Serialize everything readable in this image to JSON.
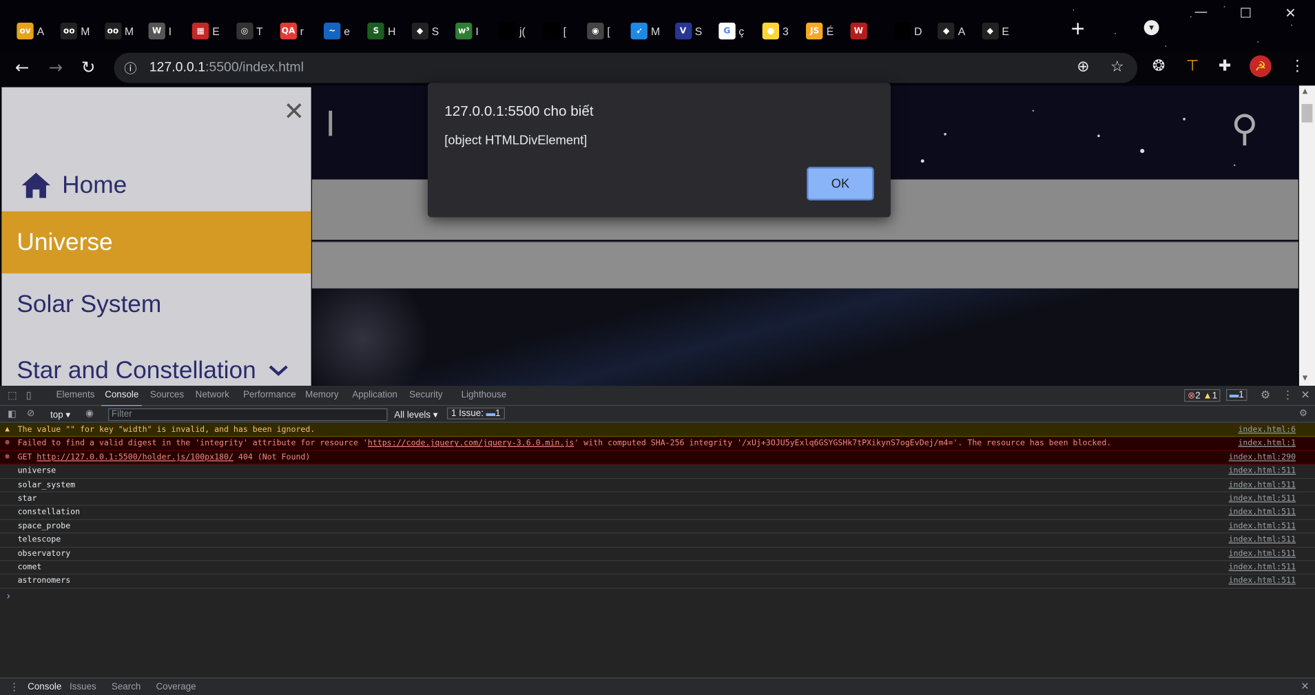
{
  "browser": {
    "tabs": [
      {
        "icon": "ov-icon",
        "text": "A",
        "color": "#e8a317",
        "label": "ov"
      },
      {
        "icon": "owl-icon",
        "text": "M",
        "color": "#222",
        "label": "oo"
      },
      {
        "icon": "owl-icon",
        "text": "M",
        "color": "#222",
        "label": "oo"
      },
      {
        "icon": "wiki-icon",
        "text": "I",
        "color": "#555",
        "label": "W"
      },
      {
        "icon": "grid-icon",
        "text": "E",
        "color": "#c62828",
        "label": "▦"
      },
      {
        "icon": "chrome-icon",
        "text": "T",
        "color": "#333",
        "label": "◎"
      },
      {
        "icon": "qa-icon",
        "text": "r",
        "color": "#e53935",
        "label": "QA"
      },
      {
        "icon": "wave-icon",
        "text": "e",
        "color": "#1565c0",
        "label": "~"
      },
      {
        "icon": "s-icon",
        "text": "H",
        "color": "#1b5e20",
        "label": "S"
      },
      {
        "icon": "bird-icon",
        "text": "S",
        "color": "#222",
        "label": "◆"
      },
      {
        "icon": "w3-icon",
        "text": "I",
        "color": "#2e7d32",
        "label": "w³"
      },
      {
        "icon": "blank-icon",
        "text": "j(",
        "color": "#000",
        "label": ""
      },
      {
        "icon": "blank-icon",
        "text": "[",
        "color": "#000",
        "label": ""
      },
      {
        "icon": "globe-icon",
        "text": "[",
        "color": "#444",
        "label": "◉"
      },
      {
        "icon": "fish-icon",
        "text": "M",
        "color": "#1e88e5",
        "label": "➶"
      },
      {
        "icon": "v-icon",
        "text": "S",
        "color": "#283593",
        "label": "V"
      },
      {
        "icon": "google-icon",
        "text": "ç",
        "color": "#fff",
        "label": "G"
      },
      {
        "icon": "moon-icon",
        "text": "3",
        "color": "#fdd835",
        "label": "●"
      },
      {
        "icon": "js-icon",
        "text": "É",
        "color": "#f9a825",
        "label": "JS"
      },
      {
        "icon": "wiki-red-icon",
        "text": "",
        "color": "#b71c1c",
        "label": "W"
      },
      {
        "icon": "blank-icon",
        "text": "D",
        "color": "#000",
        "label": ""
      },
      {
        "icon": "bird-icon",
        "text": "A",
        "color": "#222",
        "label": "◆"
      },
      {
        "icon": "bird-icon",
        "text": "E",
        "color": "#222",
        "label": "◆"
      }
    ],
    "new_tab": "+",
    "url_host": "127.0.0.1",
    "url_rest": ":5500/index.html"
  },
  "page": {
    "menu": [
      {
        "label": "Home",
        "icon": "home-icon"
      },
      {
        "label": "Universe"
      },
      {
        "label": "Solar System"
      },
      {
        "label": "Star and Constellation",
        "icon": "chevron-down-icon"
      }
    ],
    "close_glyph": "✕"
  },
  "alert": {
    "title": "127.0.0.1:5500 cho biết",
    "message": "[object HTMLDivElement]",
    "ok_label": "OK"
  },
  "devtools": {
    "tabs": [
      "Elements",
      "Console",
      "Sources",
      "Network",
      "Performance",
      "Memory",
      "Application",
      "Security",
      "Lighthouse"
    ],
    "active_tab": "Console",
    "badges": {
      "errors": "2",
      "warnings": "1",
      "messages": "1"
    },
    "context": "top",
    "filter_placeholder": "Filter",
    "levels": "All levels",
    "issues": "1 Issue:",
    "issues_count": "1",
    "logs": [
      {
        "type": "warn",
        "text": "The value \"\" for key \"width\" is invalid, and has been ignored.",
        "src": "index.html:6"
      },
      {
        "type": "err",
        "pre": "Failed to find a valid digest in the 'integrity' attribute for resource '",
        "link": "https://code.jquery.com/jquery-3.6.0.min.js",
        "post": "' with computed SHA-256 integrity '/xUj+3OJU5yExlq6GSYGSHk7tPXikynS7ogEvDej/m4='. The resource has been blocked.",
        "src": "index.html:1"
      },
      {
        "type": "err",
        "pre": "GET ",
        "link": "http://127.0.0.1:5500/holder.js/100px180/",
        "post": " 404 (Not Found)",
        "src": "index.html:290"
      },
      {
        "type": "log",
        "text": "universe",
        "src": "index.html:511"
      },
      {
        "type": "log",
        "text": "solar_system",
        "src": "index.html:511"
      },
      {
        "type": "log",
        "text": "star",
        "src": "index.html:511"
      },
      {
        "type": "log",
        "text": "constellation",
        "src": "index.html:511"
      },
      {
        "type": "log",
        "text": "space_probe",
        "src": "index.html:511"
      },
      {
        "type": "log",
        "text": "telescope",
        "src": "index.html:511"
      },
      {
        "type": "log",
        "text": "observatory",
        "src": "index.html:511"
      },
      {
        "type": "log",
        "text": "comet",
        "src": "index.html:511"
      },
      {
        "type": "log",
        "text": "astronomers",
        "src": "index.html:511"
      }
    ],
    "drawer_tabs": [
      "Console",
      "Issues",
      "Search",
      "Coverage"
    ]
  }
}
